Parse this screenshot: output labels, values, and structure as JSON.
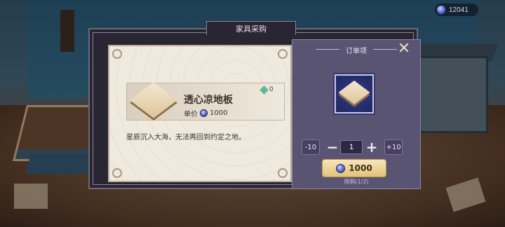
{
  "currency": {
    "icon": "gem-icon",
    "amount": "12041"
  },
  "dialog": {
    "title": "家具采购"
  },
  "item": {
    "name": "透心凉地板",
    "price_label": "单价",
    "price": "1000",
    "owned": "0",
    "description": "星辰沉入大海，无法再回到约定之地。"
  },
  "order": {
    "title": "订单项",
    "minus10_label": "-10",
    "plus10_label": "+10",
    "quantity": "1",
    "buy_price": "1000",
    "limit_text": "限购(1/2)"
  },
  "colors": {
    "accent_gold": "#e2c37a",
    "panel_purple": "#5a5473",
    "paper": "#efe9de"
  }
}
